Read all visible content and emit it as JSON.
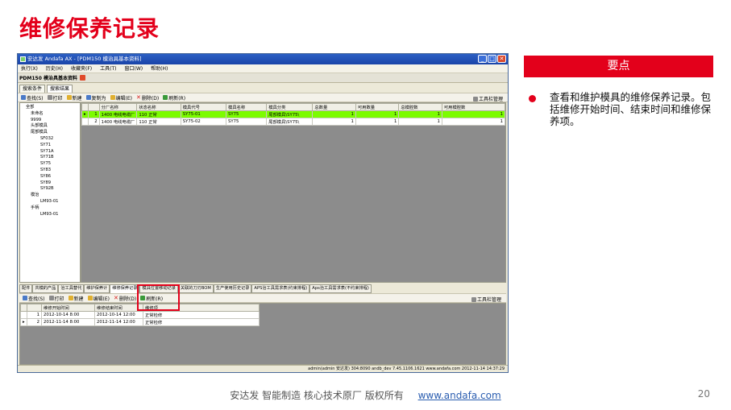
{
  "slide": {
    "title": "维修保养记录",
    "key_header": "要点",
    "key_text": "查看和维护模具的维修保养记录。包括维修开始时间、结束时间和维修保养项。",
    "footer_text": "安达发   智能制造 核心技术原厂    版权所有",
    "footer_link": "www.andafa.com",
    "page_number": "20"
  },
  "window": {
    "title": "安达发 Andafa AX - [PDM150 模治具基本资料]",
    "buttons": [
      "_",
      "□",
      "✕"
    ],
    "menu": [
      "执行(X)",
      "历史(H)",
      "收藏夹(F)",
      "工具(T)",
      "窗口(W)",
      "帮助(H)"
    ],
    "doc_tab": "PDM150 模治具基本资料",
    "panel_tabs": [
      "搜索条件",
      "搜索结果"
    ],
    "toolbar": [
      "查找(S)",
      "打印",
      "新建",
      "复制为",
      "编辑(E)",
      "删除(D)",
      "刷新(R)"
    ],
    "toolbar_manager": "工具栏管理",
    "tree": [
      "全部",
      "未命名",
      "9999",
      "头部模具",
      "尾部模具",
      "SF032",
      "SY71",
      "SY71A",
      "SY71B",
      "SY75",
      "SY83",
      "SY86",
      "SY89",
      "SY92B",
      "模治",
      "LM93-01",
      "手柄",
      "LM93-01"
    ],
    "grid": {
      "columns": [
        "分厂名称",
        "状态名称",
        "模具代号",
        "模具名称",
        "模具分类",
        "总数量",
        "可用数量",
        "总模腔数",
        "可用模腔数"
      ],
      "rows": [
        {
          "no": "1",
          "plant": "1400 电线电缆厂",
          "status": "110 正常",
          "code": "SY75-01",
          "name": "SY75",
          "category": "尾部模具\\SY75\\",
          "total": "1",
          "available": "1",
          "cav_total": "1",
          "cav_available": "1"
        },
        {
          "no": "2",
          "plant": "1400 电线电缆厂",
          "status": "110 正常",
          "code": "SY75-02",
          "name": "SY75",
          "category": "尾部模具\\SY75\\",
          "total": "1",
          "available": "1",
          "cav_total": "1",
          "cav_available": "1"
        }
      ]
    },
    "lower_tabs": [
      "配件",
      "共模的产品",
      "治工具替代",
      "维护保养计",
      "维修保养记录",
      "模具位置移动记录",
      "关联的刀刃BOM",
      "生产使用历史记录",
      "APS治工具需求表(约束排程)",
      "Aps治工具需求表(不约束排程)"
    ],
    "lower_toolbar": [
      "查找(S)",
      "打印",
      "新建",
      "编辑(E)",
      "删除(D)",
      "刷新(R)"
    ],
    "lower_grid": {
      "columns": [
        "维修开始时间",
        "维修结束时间",
        "维修项"
      ],
      "rows": [
        {
          "no": "1",
          "start": "2012-10-14 8:00",
          "end": "2012-10-14 12:00",
          "item": "正常检修"
        },
        {
          "no": "2",
          "start": "2012-11-14 8:00",
          "end": "2012-11-14 12:00",
          "item": "正常检修"
        }
      ]
    },
    "status_bar": "admin(admin 安达发)  304:8090  andb_dev  7.45.1106.1621  www.andafa.com  2012-11-14 14:37:29"
  }
}
